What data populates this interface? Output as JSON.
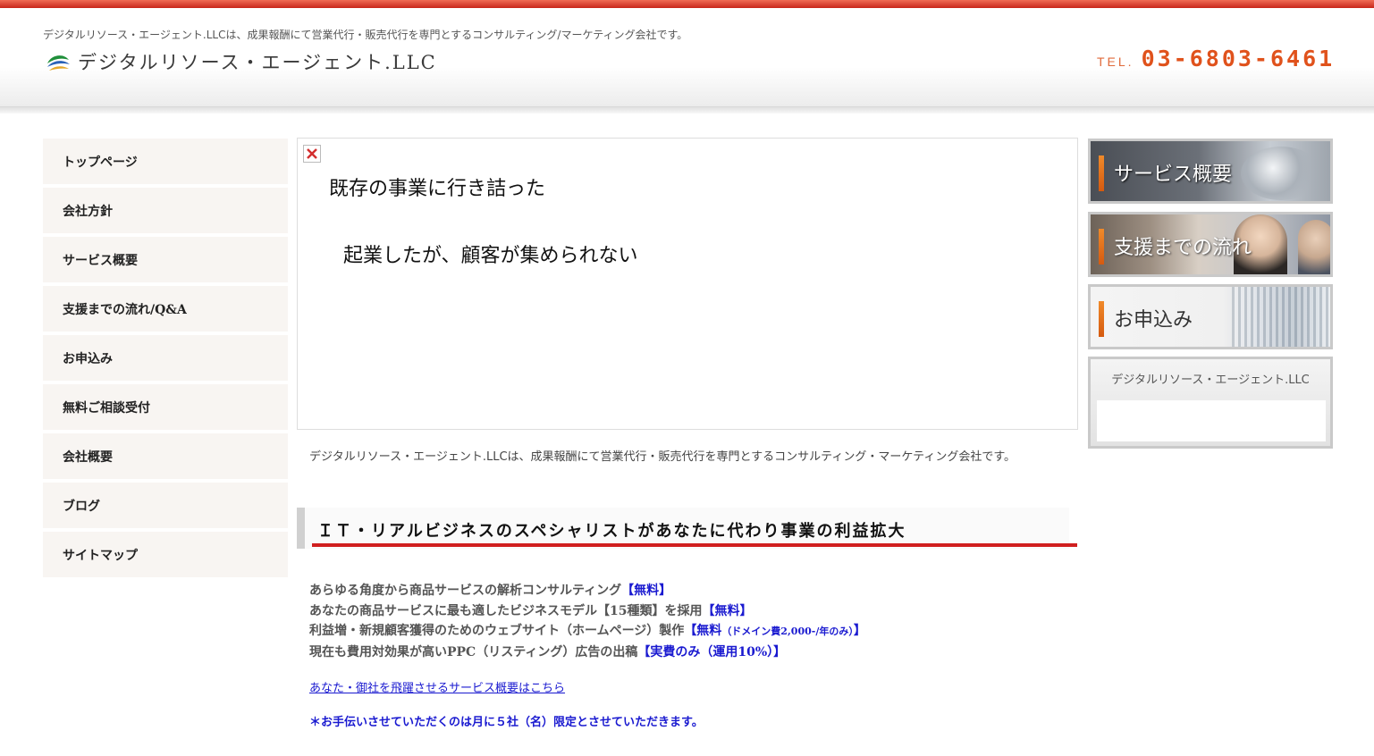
{
  "header": {
    "tagline": "デジタルリソース・エージェント.LLCは、成果報酬にて営業代行・販売代行を専門とするコンサルティング/マーケティング会社です。",
    "logo_text": "デジタルリソース・エージェント.LLC",
    "tel_label": "TEL.",
    "tel_number": "03-6803-6461"
  },
  "nav": {
    "items": [
      {
        "label": "トップページ"
      },
      {
        "label": "会社方針"
      },
      {
        "label": "サービス概要"
      },
      {
        "label": "支援までの流れ/Q&A"
      },
      {
        "label": "お申込み"
      },
      {
        "label": "無料ご相談受付"
      },
      {
        "label": "会社概要"
      },
      {
        "label": "ブログ"
      },
      {
        "label": "サイトマップ"
      }
    ]
  },
  "hero": {
    "line1": "既存の事業に行き詰った",
    "line2": "起業したが、顧客が集められない"
  },
  "intro": "デジタルリソース・エージェント.LLCは、成果報酬にて営業代行・販売代行を専門とするコンサルティング・マーケティング会社です。",
  "section_title": "ＩＴ・リアルビジネスのスペシャリストがあなたに代わり事業の利益拡大",
  "services": [
    {
      "text": "あらゆる角度から商品サービスの解析コンサルティング",
      "tag": "【無料】",
      "small": "",
      "tag_end": ""
    },
    {
      "text": "あなたの商品サービスに最も適したビジネスモデル【15種類】を採用",
      "tag": "【無料】",
      "small": "",
      "tag_end": ""
    },
    {
      "text": "利益増・新規顧客獲得のためのウェブサイト（ホームページ）製作",
      "tag": "【無料",
      "small": "（ドメイン費2,000-/年のみ）",
      "tag_end": "】"
    },
    {
      "text": "現在も費用対効果が高いPPC（リスティング）広告の出稿",
      "tag": "【実費のみ（運用10%）】",
      "small": "",
      "tag_end": ""
    }
  ],
  "service_link": "あなた・御社を飛躍させるサービス概要はこちら",
  "notice": "＊お手伝いさせていただくのは月に５社（名）限定とさせていただきます。",
  "banners": {
    "service": "サービス概要",
    "flow": "支援までの流れ",
    "apply": "お申込み"
  },
  "side_box": {
    "title": "デジタルリソース・エージェント.LLC"
  },
  "colors": {
    "accent_red": "#d01f1f",
    "tel_orange": "#e0521c",
    "link_blue": "#1a1ad0"
  }
}
